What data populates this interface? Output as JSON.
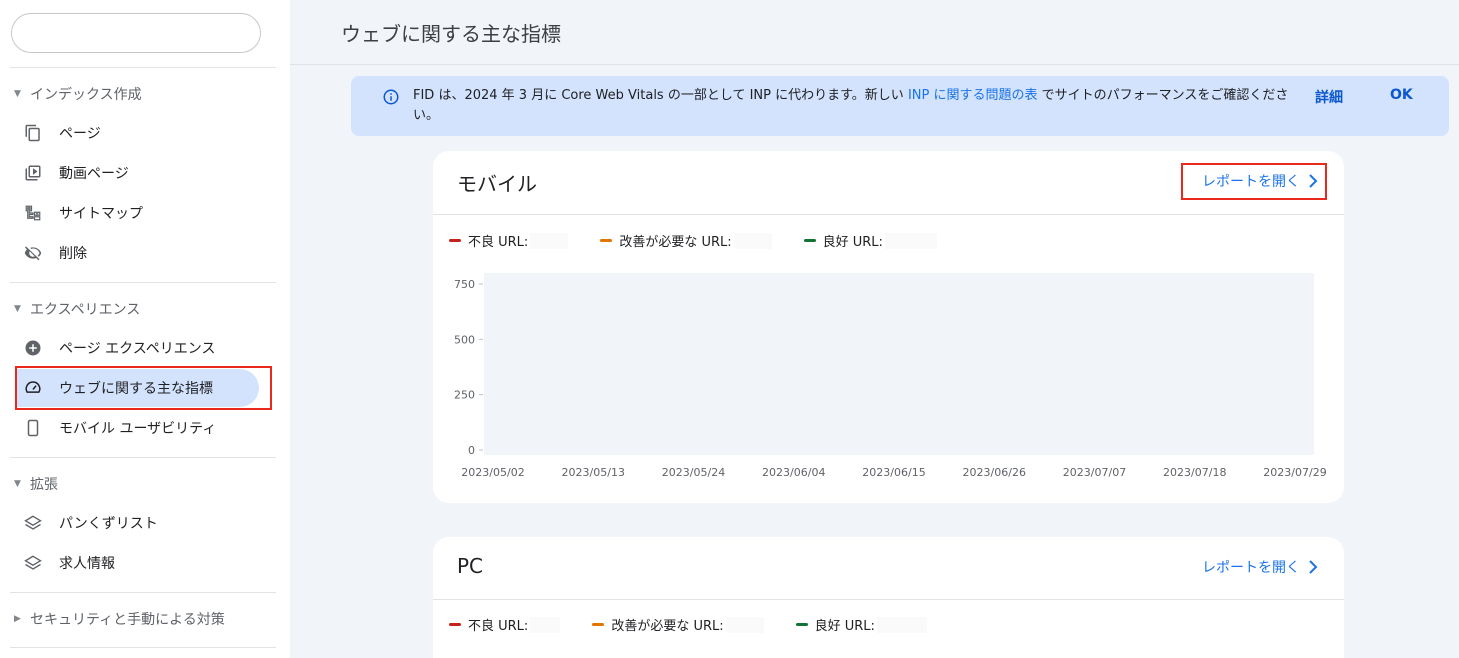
{
  "sidebar": {
    "search": {
      "placeholder": ""
    },
    "sections": [
      {
        "label": "インデックス作成",
        "items": [
          "ページ",
          "動画ページ",
          "サイトマップ",
          "削除"
        ]
      },
      {
        "label": "エクスペリエンス",
        "items": [
          "ページ エクスペリエンス",
          "ウェブに関する主な指標",
          "モバイル ユーザビリティ"
        ]
      },
      {
        "label": "拡張",
        "items": [
          "パンくずリスト",
          "求人情報"
        ]
      },
      {
        "label": "セキュリティと手動による対策"
      }
    ],
    "active_item": "ウェブに関する主な指標"
  },
  "header": {
    "title": "ウェブに関する主な指標"
  },
  "banner": {
    "text_before": "FID は、2024 年 3 月に Core Web Vitals の一部として INP に代わります。新しい ",
    "link": "INP に関する問題の表",
    "text_after": " でサイトのパフォーマンスをご確認ください。",
    "details_label": "詳細",
    "ok_label": "OK"
  },
  "cards": [
    {
      "title": "モバイル",
      "link_label": "レポートを開く",
      "legend": [
        {
          "label": "不良 URL:",
          "color": "#c5221f"
        },
        {
          "label": "改善が必要な URL:",
          "color": "#e37400"
        },
        {
          "label": "良好 URL:",
          "color": "#137333"
        }
      ]
    },
    {
      "title": "PC",
      "link_label": "レポートを開く",
      "legend": [
        {
          "label": "不良 URL:",
          "color": "#c5221f"
        },
        {
          "label": "改善が必要な URL:",
          "color": "#e37400"
        },
        {
          "label": "良好 URL:",
          "color": "#137333"
        }
      ]
    }
  ],
  "chart_data": {
    "type": "area",
    "categories": [
      "2023/05/02",
      "2023/05/13",
      "2023/05/24",
      "2023/06/04",
      "2023/06/15",
      "2023/06/26",
      "2023/07/07",
      "2023/07/18",
      "2023/07/29"
    ],
    "y_ticks": [
      "750",
      "500",
      "250",
      "0"
    ],
    "ylim": [
      0,
      750
    ],
    "series": [],
    "grid": false
  }
}
